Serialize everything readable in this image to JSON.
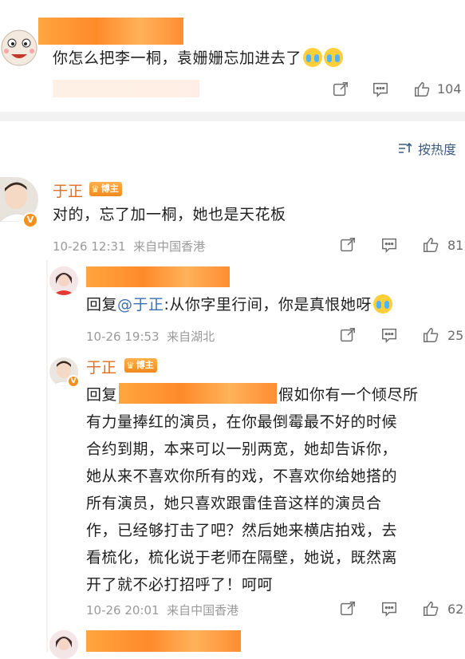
{
  "comment1": {
    "text": "你怎么把李一桐，袁姗姗忘加进去了",
    "like_count": "104"
  },
  "sort": {
    "label": "按热度"
  },
  "comment2": {
    "author": "于正",
    "badge": "博主",
    "text": "对的，忘了加一桐，她也是天花板",
    "time": "10-26 12:31",
    "location": "来自中国香港",
    "like_count": "81"
  },
  "reply1": {
    "prefix": "回复",
    "mention": "@于正",
    "text": ":从你字里行间，你是真恨她呀",
    "time": "10-26 19:53",
    "location": "来自湖北",
    "like_count": "25"
  },
  "reply2": {
    "author": "于正",
    "badge": "博主",
    "prefix": "回复",
    "line1_tail": "假如你有一个倾尽所",
    "lines": [
      "有力量捧红的演员，在你最倒霉最不好的时候",
      "合约到期，本来可以一别两宽，她却告诉你，",
      "她从来不喜欢你所有的戏，不喜欢你给她搭的",
      "所有演员，她只喜欢跟雷佳音这样的演员合",
      "作，已经够打击了吧？然后她来横店拍戏，去",
      "看梳化，梳化说于老师在隔壁，她说，既然离",
      "开了就不必打招呼了！呵呵"
    ],
    "time": "10-26 20:01",
    "location": "来自中国香港",
    "like_count": "62"
  },
  "icons": [
    "share-icon",
    "comment-icon",
    "like-icon",
    "sort-icon",
    "crown-icon",
    "verified-icon",
    "crying-emoji",
    "teary-emoji"
  ],
  "colors": {
    "name": "#e06d24",
    "link": "#3a6fb0",
    "meta": "#9a9a9a",
    "redaction": "#ff9a33",
    "badge": "#f29121"
  }
}
